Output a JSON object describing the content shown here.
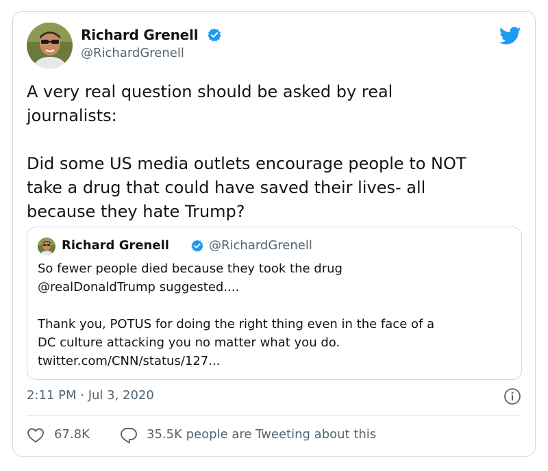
{
  "tweet": {
    "author_name": "Richard Grenell",
    "author_handle": "@RichardGrenell",
    "text": "A very real question should be asked by real\njournalists:\n\nDid some US media outlets encourage people to NOT\ntake a drug that could have saved their lives- all\nbecause they hate Trump?",
    "timestamp": "2:11 PM · Jul 3, 2020",
    "like_count": "67.8K",
    "tweeting_about": "35.5K people are Tweeting about this"
  },
  "quoted_tweet": {
    "author_name": "Richard Grenell",
    "author_handle": "@RichardGrenell",
    "text": "So fewer people died because they took the drug\n@realDonaldTrump suggested....\n\nThank you, POTUS for doing the right thing even in the face of a\nDC culture attacking you no matter what you do.\ntwitter.com/CNN/status/127..."
  },
  "icons": {
    "brand": "twitter-bird-icon",
    "verified": "verified-badge-icon",
    "info": "info-icon",
    "like": "heart-icon",
    "reply": "speech-bubble-icon"
  },
  "colors": {
    "brand_blue": "#1d9bf0",
    "text_primary": "#0f1419",
    "text_secondary": "#536471",
    "border": "#cfd9de"
  }
}
